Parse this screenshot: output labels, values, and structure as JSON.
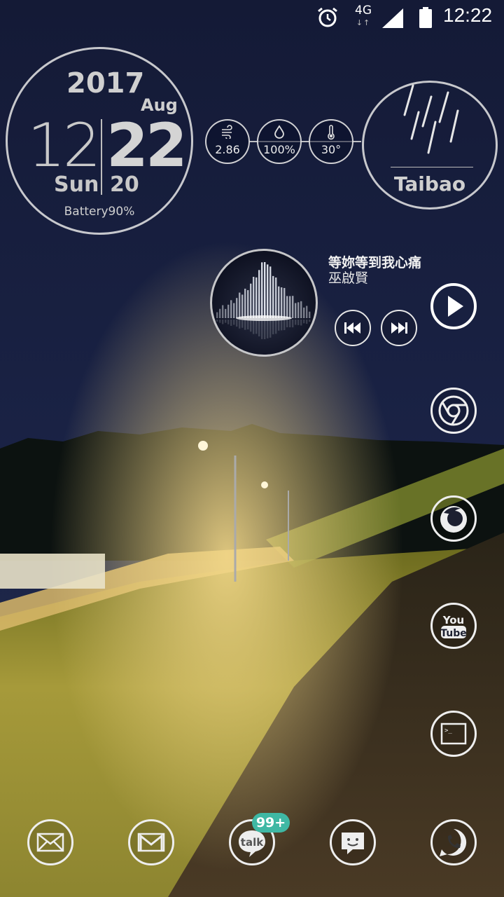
{
  "status_bar": {
    "network_type": "4G",
    "network_arrows": "↓↑",
    "time": "12:22",
    "icons": [
      "alarm-icon",
      "signal-icon",
      "battery-icon"
    ]
  },
  "clock_widget": {
    "year": "2017",
    "month": "Aug",
    "hour": "12",
    "minute": "22",
    "day_of_week": "Sun",
    "second": "20",
    "battery": "Battery90%"
  },
  "weather_widget": {
    "wind": "2.86",
    "humidity": "100%",
    "temperature": "30°",
    "city": "Taibao",
    "condition_icon": "rain-icon"
  },
  "music_widget": {
    "song_title": "等妳等到我心痛",
    "artist": "巫啟賢",
    "buttons": [
      "previous-button",
      "next-button",
      "play-button"
    ]
  },
  "side_apps": [
    {
      "name": "chrome",
      "icon": "chrome-icon"
    },
    {
      "name": "firefox",
      "icon": "firefox-icon"
    },
    {
      "name": "youtube",
      "icon": "youtube-icon",
      "label_top": "You",
      "label_bottom": "Tube"
    },
    {
      "name": "terminal",
      "icon": "terminal-icon",
      "prompt": ">_"
    }
  ],
  "dock": {
    "apps": [
      {
        "name": "email",
        "icon": "envelope-icon"
      },
      {
        "name": "gmail",
        "icon": "gmail-icon"
      },
      {
        "name": "talk",
        "icon": "talk-icon",
        "label": "talk",
        "badge": "99+"
      },
      {
        "name": "messages",
        "icon": "message-icon"
      },
      {
        "name": "phone",
        "icon": "phone-icon"
      }
    ]
  }
}
